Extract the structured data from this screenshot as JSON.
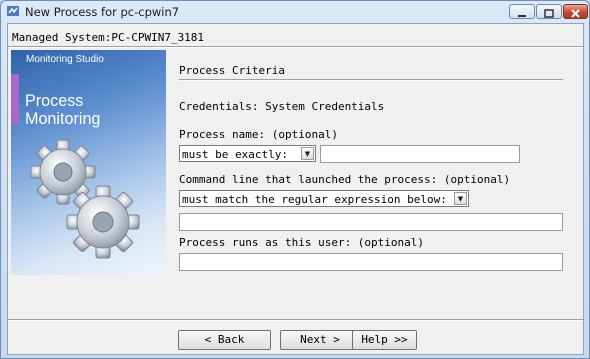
{
  "window": {
    "title": "New Process for pc-cpwin7"
  },
  "header": {
    "managed_system": "Managed System:PC-CPWIN7_3181"
  },
  "banner": {
    "brand": "Monitoring Studio",
    "title_line1": "Process",
    "title_line2": "Monitoring"
  },
  "section": {
    "title": "Process Criteria"
  },
  "credentials": "Credentials: System Credentials",
  "process_name": {
    "label": "Process name: (optional)",
    "match_option": "must be exactly:",
    "value": ""
  },
  "command_line": {
    "label": "Command line that launched the process: (optional)",
    "match_option": "must match the regular expression below:",
    "value": ""
  },
  "runs_as_user": {
    "label": "Process runs as this user: (optional)",
    "value": ""
  },
  "buttons": {
    "back": "< Back",
    "next": "Next >",
    "help": "Help >>"
  },
  "colors": {
    "title_bar": "#c6d9ee",
    "client_bg": "#f0f0f0",
    "close_button": "#c74a33",
    "banner_blue": "#2f63a8"
  }
}
